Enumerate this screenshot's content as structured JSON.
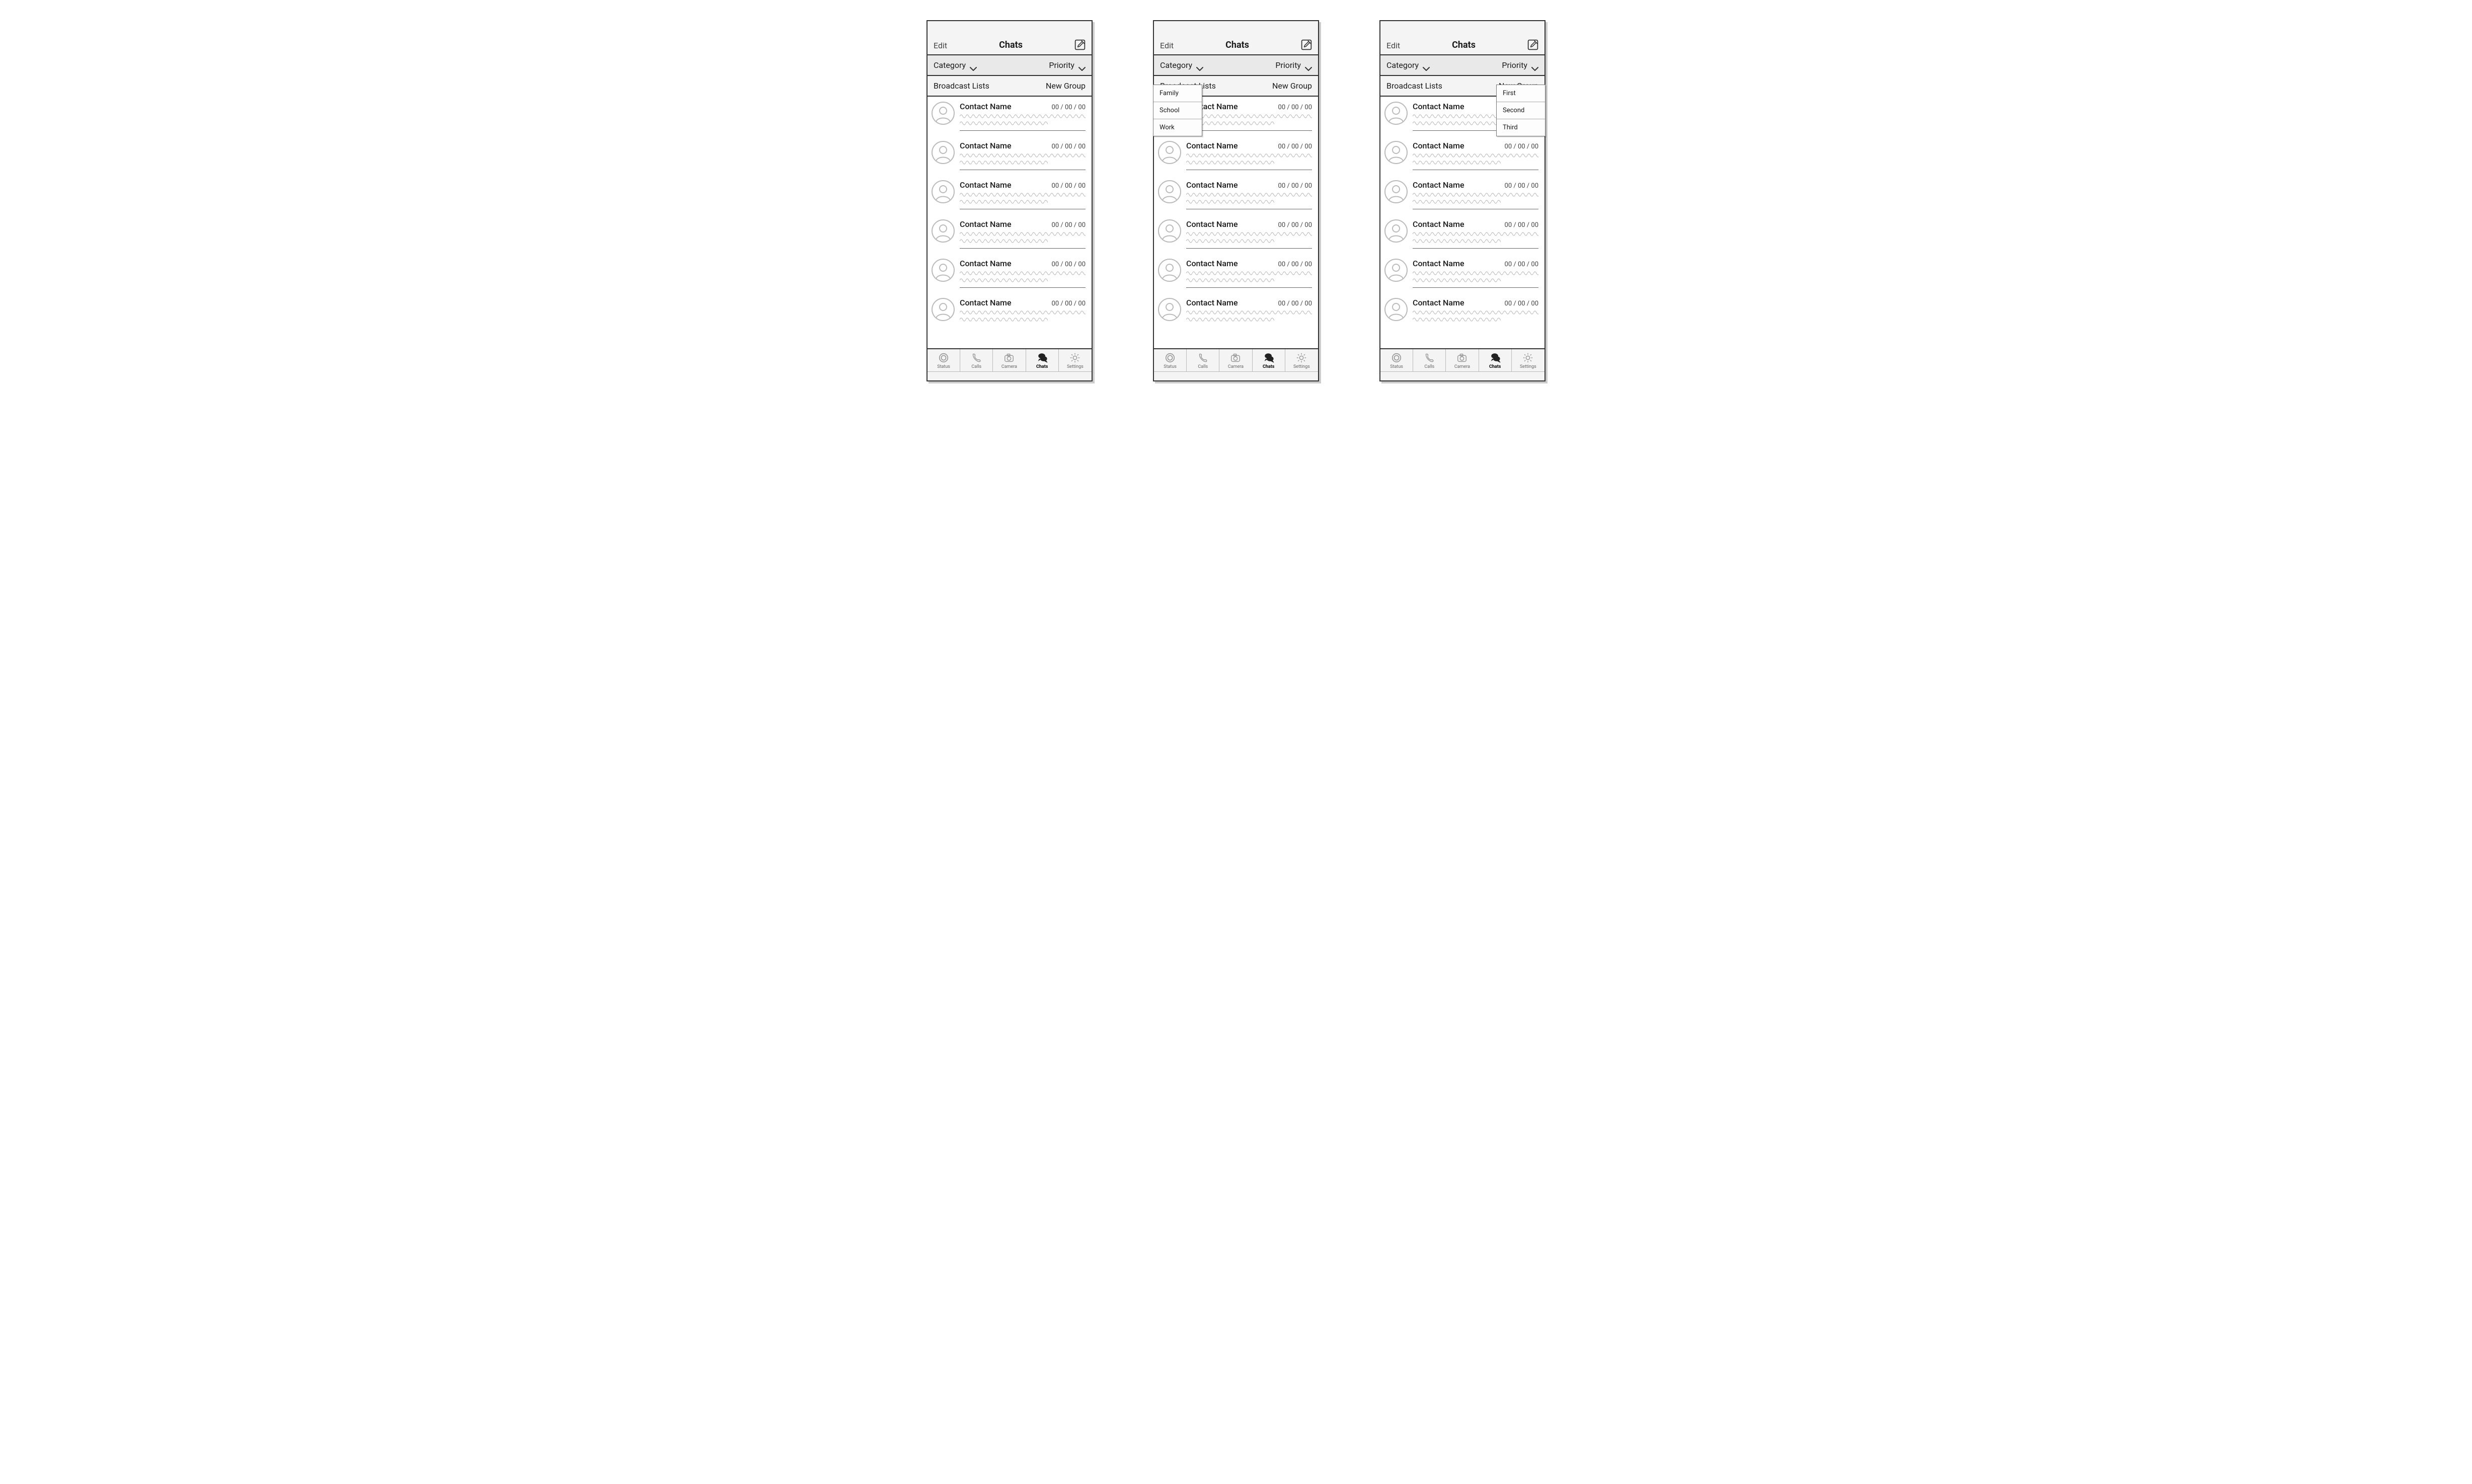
{
  "header": {
    "edit": "Edit",
    "title": "Chats"
  },
  "filters": {
    "category_label": "Category",
    "priority_label": "Priority"
  },
  "listbar": {
    "broadcast": "Broadcast Lists",
    "newgroup": "New Group"
  },
  "chats": [
    {
      "name": "Contact Name",
      "date": "00 / 00 / 00"
    },
    {
      "name": "Contact Name",
      "date": "00 / 00 / 00"
    },
    {
      "name": "Contact Name",
      "date": "00 / 00 / 00"
    },
    {
      "name": "Contact Name",
      "date": "00 / 00 / 00"
    },
    {
      "name": "Contact Name",
      "date": "00 / 00 / 00"
    },
    {
      "name": "Contact Name",
      "date": "00 / 00 / 00"
    }
  ],
  "tabs": [
    {
      "key": "status",
      "label": "Status"
    },
    {
      "key": "calls",
      "label": "Calls"
    },
    {
      "key": "camera",
      "label": "Camera"
    },
    {
      "key": "chats",
      "label": "Chats"
    },
    {
      "key": "settings",
      "label": "Settings"
    }
  ],
  "active_tab": "chats",
  "category_menu": [
    "Family",
    "School",
    "Work"
  ],
  "priority_menu": [
    "First",
    "Second",
    "Third"
  ]
}
